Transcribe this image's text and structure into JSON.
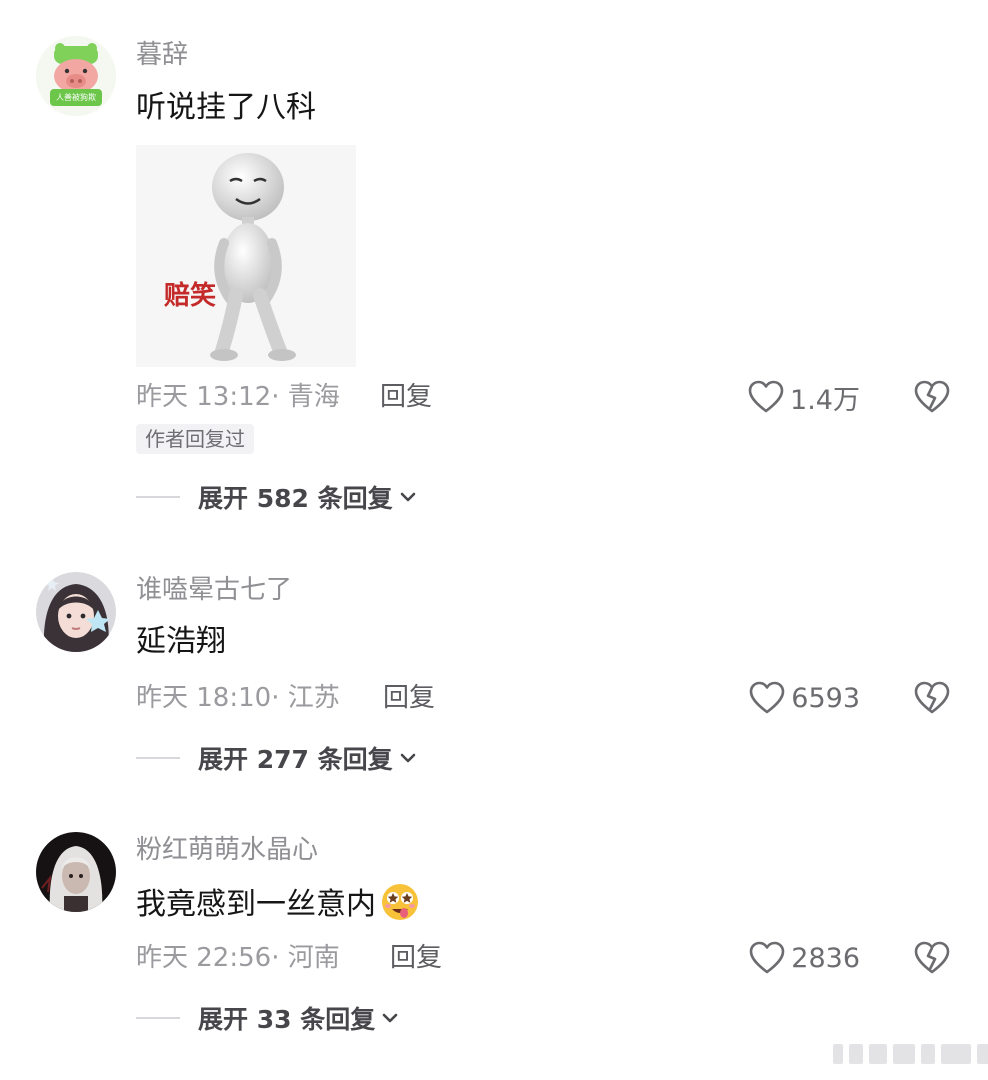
{
  "comments": [
    {
      "username": "暮辞",
      "text": "听说挂了八科",
      "sticker_caption": "赔笑",
      "avatar_caption": "人善被狗欺",
      "meta": "昨天 13:12· 青海",
      "reply_label": "回复",
      "likes": "1.4万",
      "author_badge": "作者回复过",
      "expand_label": "展开 582 条回复"
    },
    {
      "username": "谁嗑晕古七了",
      "text": "延浩翔",
      "meta": "昨天 18:10· 江苏",
      "reply_label": "回复",
      "likes": "6593",
      "expand_label": "展开 277 条回复"
    },
    {
      "username": "粉红萌萌水晶心",
      "text": "我竟感到一丝意内",
      "meta": "昨天 22:56· 河南",
      "reply_label": "回复",
      "likes": "2836",
      "expand_label": "展开 33 条回复"
    }
  ],
  "icons": {
    "like": "heart-outline-icon",
    "dislike": "broken-heart-icon",
    "expand": "chevron-down-icon",
    "emoji": "drooling-star-eyes-emoji"
  },
  "colors": {
    "username": "#8f8f94",
    "text": "#161616",
    "meta": "#9a9a9f",
    "badge_bg": "#f2f2f4",
    "sticker_caption": "#c42a2a"
  }
}
